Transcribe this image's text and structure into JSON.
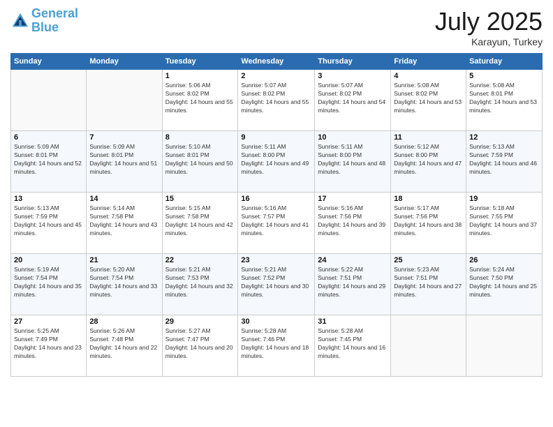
{
  "header": {
    "logo_line1": "General",
    "logo_line2": "Blue",
    "month": "July 2025",
    "location": "Karayun, Turkey"
  },
  "weekdays": [
    "Sunday",
    "Monday",
    "Tuesday",
    "Wednesday",
    "Thursday",
    "Friday",
    "Saturday"
  ],
  "weeks": [
    [
      {
        "day": "",
        "info": ""
      },
      {
        "day": "",
        "info": ""
      },
      {
        "day": "1",
        "info": "Sunrise: 5:06 AM\nSunset: 8:02 PM\nDaylight: 14 hours and 55 minutes."
      },
      {
        "day": "2",
        "info": "Sunrise: 5:07 AM\nSunset: 8:02 PM\nDaylight: 14 hours and 55 minutes."
      },
      {
        "day": "3",
        "info": "Sunrise: 5:07 AM\nSunset: 8:02 PM\nDaylight: 14 hours and 54 minutes."
      },
      {
        "day": "4",
        "info": "Sunrise: 5:08 AM\nSunset: 8:02 PM\nDaylight: 14 hours and 53 minutes."
      },
      {
        "day": "5",
        "info": "Sunrise: 5:08 AM\nSunset: 8:01 PM\nDaylight: 14 hours and 53 minutes."
      }
    ],
    [
      {
        "day": "6",
        "info": "Sunrise: 5:09 AM\nSunset: 8:01 PM\nDaylight: 14 hours and 52 minutes."
      },
      {
        "day": "7",
        "info": "Sunrise: 5:09 AM\nSunset: 8:01 PM\nDaylight: 14 hours and 51 minutes."
      },
      {
        "day": "8",
        "info": "Sunrise: 5:10 AM\nSunset: 8:01 PM\nDaylight: 14 hours and 50 minutes."
      },
      {
        "day": "9",
        "info": "Sunrise: 5:11 AM\nSunset: 8:00 PM\nDaylight: 14 hours and 49 minutes."
      },
      {
        "day": "10",
        "info": "Sunrise: 5:11 AM\nSunset: 8:00 PM\nDaylight: 14 hours and 48 minutes."
      },
      {
        "day": "11",
        "info": "Sunrise: 5:12 AM\nSunset: 8:00 PM\nDaylight: 14 hours and 47 minutes."
      },
      {
        "day": "12",
        "info": "Sunrise: 5:13 AM\nSunset: 7:59 PM\nDaylight: 14 hours and 46 minutes."
      }
    ],
    [
      {
        "day": "13",
        "info": "Sunrise: 5:13 AM\nSunset: 7:59 PM\nDaylight: 14 hours and 45 minutes."
      },
      {
        "day": "14",
        "info": "Sunrise: 5:14 AM\nSunset: 7:58 PM\nDaylight: 14 hours and 43 minutes."
      },
      {
        "day": "15",
        "info": "Sunrise: 5:15 AM\nSunset: 7:58 PM\nDaylight: 14 hours and 42 minutes."
      },
      {
        "day": "16",
        "info": "Sunrise: 5:16 AM\nSunset: 7:57 PM\nDaylight: 14 hours and 41 minutes."
      },
      {
        "day": "17",
        "info": "Sunrise: 5:16 AM\nSunset: 7:56 PM\nDaylight: 14 hours and 39 minutes."
      },
      {
        "day": "18",
        "info": "Sunrise: 5:17 AM\nSunset: 7:56 PM\nDaylight: 14 hours and 38 minutes."
      },
      {
        "day": "19",
        "info": "Sunrise: 5:18 AM\nSunset: 7:55 PM\nDaylight: 14 hours and 37 minutes."
      }
    ],
    [
      {
        "day": "20",
        "info": "Sunrise: 5:19 AM\nSunset: 7:54 PM\nDaylight: 14 hours and 35 minutes."
      },
      {
        "day": "21",
        "info": "Sunrise: 5:20 AM\nSunset: 7:54 PM\nDaylight: 14 hours and 33 minutes."
      },
      {
        "day": "22",
        "info": "Sunrise: 5:21 AM\nSunset: 7:53 PM\nDaylight: 14 hours and 32 minutes."
      },
      {
        "day": "23",
        "info": "Sunrise: 5:21 AM\nSunset: 7:52 PM\nDaylight: 14 hours and 30 minutes."
      },
      {
        "day": "24",
        "info": "Sunrise: 5:22 AM\nSunset: 7:51 PM\nDaylight: 14 hours and 29 minutes."
      },
      {
        "day": "25",
        "info": "Sunrise: 5:23 AM\nSunset: 7:51 PM\nDaylight: 14 hours and 27 minutes."
      },
      {
        "day": "26",
        "info": "Sunrise: 5:24 AM\nSunset: 7:50 PM\nDaylight: 14 hours and 25 minutes."
      }
    ],
    [
      {
        "day": "27",
        "info": "Sunrise: 5:25 AM\nSunset: 7:49 PM\nDaylight: 14 hours and 23 minutes."
      },
      {
        "day": "28",
        "info": "Sunrise: 5:26 AM\nSunset: 7:48 PM\nDaylight: 14 hours and 22 minutes."
      },
      {
        "day": "29",
        "info": "Sunrise: 5:27 AM\nSunset: 7:47 PM\nDaylight: 14 hours and 20 minutes."
      },
      {
        "day": "30",
        "info": "Sunrise: 5:28 AM\nSunset: 7:46 PM\nDaylight: 14 hours and 18 minutes."
      },
      {
        "day": "31",
        "info": "Sunrise: 5:28 AM\nSunset: 7:45 PM\nDaylight: 14 hours and 16 minutes."
      },
      {
        "day": "",
        "info": ""
      },
      {
        "day": "",
        "info": ""
      }
    ]
  ]
}
